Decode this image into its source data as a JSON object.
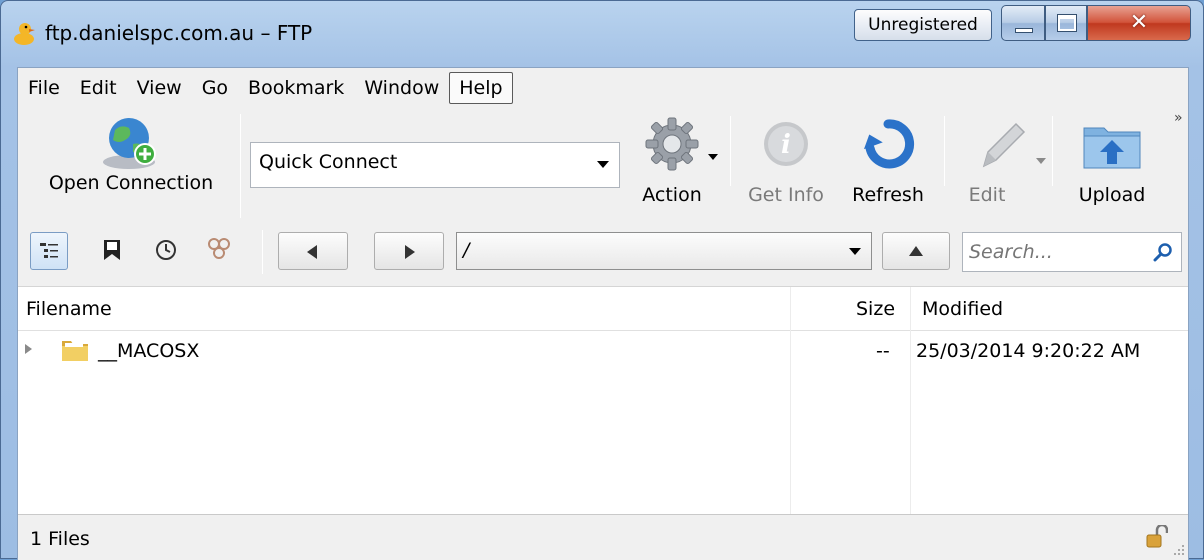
{
  "window": {
    "title": "ftp.danielspc.com.au – FTP",
    "unregistered_label": "Unregistered",
    "caption_buttons": [
      "minimize",
      "maximize",
      "close"
    ]
  },
  "menu": [
    "File",
    "Edit",
    "View",
    "Go",
    "Bookmark",
    "Window",
    "Help"
  ],
  "toolbar": {
    "open_connection": "Open Connection",
    "quick_connect": "Quick Connect",
    "action": "Action",
    "get_info": "Get Info",
    "refresh": "Refresh",
    "edit": "Edit",
    "upload": "Upload",
    "overflow": "»"
  },
  "navbar": {
    "path": "/",
    "search_placeholder": "Search..."
  },
  "table": {
    "columns": [
      "Filename",
      "Size",
      "Modified"
    ],
    "rows": [
      {
        "name": "__MACOSX",
        "size": "--",
        "modified": "25/03/2014 9:20:22 AM"
      }
    ]
  },
  "status": {
    "text": "1 Files"
  },
  "colors": {
    "accent": "#3a78c4",
    "close_button": "#c8442a",
    "folder": "#e6c24e"
  }
}
